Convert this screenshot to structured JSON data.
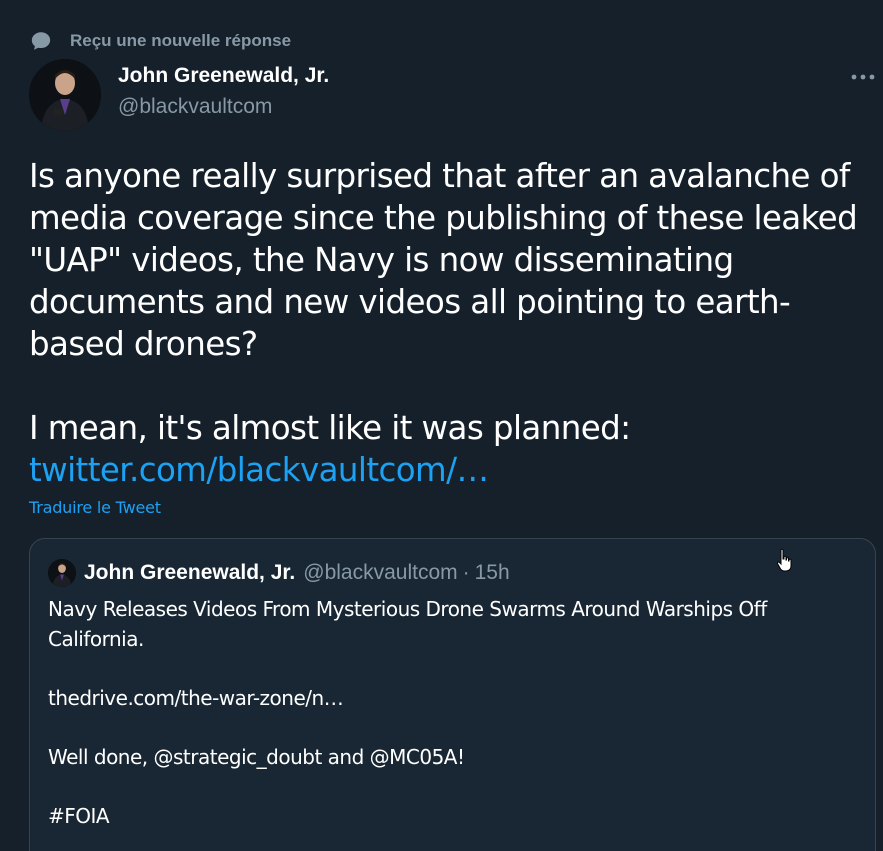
{
  "context": {
    "icon": "speech-bubble-icon",
    "text": "Reçu une nouvelle réponse"
  },
  "author": {
    "name": "John Greenewald, Jr.",
    "handle": "@blackvaultcom",
    "avatar": "avatar-photo"
  },
  "more": {
    "icon": "more-horizontal-icon",
    "label": "···"
  },
  "tweet": {
    "paragraph1": "Is anyone really surprised that after an avalanche of media coverage since the publishing of these leaked \"UAP\" videos, the Navy is now disseminating documents and new videos all pointing to earth-based drones?",
    "paragraph2": "I mean, it's almost like it was planned:",
    "link": "twitter.com/blackvaultcom/…"
  },
  "translate": {
    "label": "Traduire le Tweet"
  },
  "quoted": {
    "name": "John Greenewald, Jr.",
    "handle": "@blackvaultcom",
    "separator": "·",
    "time": "15h",
    "line1": "Navy Releases Videos From Mysterious Drone Swarms Around Warships Off California.",
    "line2": "thedrive.com/the-war-zone/n…",
    "line3": "Well done, @strategic_doubt and @MC05A!",
    "line4": "#FOIA"
  },
  "colors": {
    "background": "#15202b",
    "card": "#192734",
    "border": "#38444d",
    "accent": "#1da1f2",
    "muted": "#8899a6"
  }
}
